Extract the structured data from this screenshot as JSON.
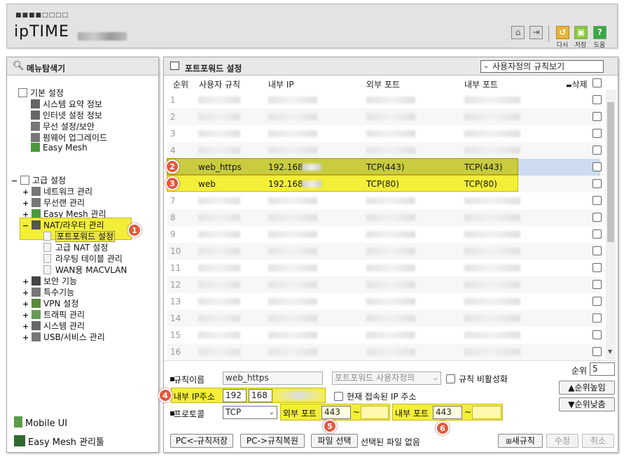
{
  "header": {
    "brand_dots": "■■■■□□□□",
    "brand": "ipTIME",
    "buttons": [
      {
        "label": "다시",
        "icon": "refresh-icon"
      },
      {
        "label": "저장",
        "icon": "save-icon"
      },
      {
        "label": "도움",
        "icon": "help-icon"
      }
    ]
  },
  "sidebar": {
    "title": "메뉴탐색기",
    "basic": {
      "label": "기본 설정",
      "items": [
        "시스템 요약 정보",
        "인터넷 설정 정보",
        "무선 설정/보안",
        "펌웨어 업그레이드",
        "Easy Mesh"
      ]
    },
    "advanced": {
      "label": "고급 설정",
      "items": [
        "네트워크 관리",
        "무선랜 관리",
        "Easy Mesh 관리",
        "NAT/라우터 관리"
      ]
    },
    "nat_children": [
      "포트포워드 설정",
      "고급 NAT 설정",
      "라우팅 테이블 관리",
      "WAN용 MACVLAN"
    ],
    "advanced_rest": [
      "보안 기능",
      "특수기능",
      "VPN 설정",
      "트래픽 관리",
      "시스템 관리",
      "USB/서비스 관리"
    ],
    "bottom": [
      "Mobile UI",
      "Easy Mesh 관리툴"
    ],
    "badge1": "1"
  },
  "main": {
    "title": "포트포워드 설정",
    "view_select": "사용자정의 규칙보기",
    "columns": [
      "순위",
      "사용자 규칙",
      "내부 IP",
      "외부 포트",
      "내부 포트",
      "삭제"
    ],
    "rows": [
      {
        "n": "1",
        "name": "",
        "ip": "",
        "ext": "",
        "int": ""
      },
      {
        "n": "2",
        "name": "",
        "ip": "",
        "ext": "",
        "int": ""
      },
      {
        "n": "3",
        "name": "",
        "ip": "",
        "ext": "",
        "int": ""
      },
      {
        "n": "4",
        "name": "",
        "ip": "",
        "ext": "",
        "int": ""
      },
      {
        "n": "",
        "name": "web_https",
        "ip": "192.168",
        "ext": "TCP(443)",
        "int": "TCP(443)",
        "badge": "2"
      },
      {
        "n": "",
        "name": "web",
        "ip": "192.168",
        "ext": "TCP(80)",
        "int": "TCP(80)",
        "badge": "3"
      },
      {
        "n": "7",
        "name": "",
        "ip": "",
        "ext": "",
        "int": ""
      },
      {
        "n": "8",
        "name": "",
        "ip": "",
        "ext": "",
        "int": ""
      },
      {
        "n": "9",
        "name": "",
        "ip": "",
        "ext": "",
        "int": ""
      },
      {
        "n": "10",
        "name": "",
        "ip": "",
        "ext": "",
        "int": ""
      },
      {
        "n": "11",
        "name": "",
        "ip": "",
        "ext": "",
        "int": ""
      },
      {
        "n": "12",
        "name": "",
        "ip": "",
        "ext": "",
        "int": ""
      },
      {
        "n": "13",
        "name": "",
        "ip": "",
        "ext": "",
        "int": ""
      },
      {
        "n": "14",
        "name": "",
        "ip": "",
        "ext": "",
        "int": ""
      },
      {
        "n": "15",
        "name": "",
        "ip": "",
        "ext": "",
        "int": ""
      },
      {
        "n": "16",
        "name": "",
        "ip": "",
        "ext": "",
        "int": ""
      }
    ],
    "form": {
      "rule_name_label": "규칙이름",
      "rule_name_value": "web_https",
      "rule_type": "포트포워드 사용자정의",
      "disable_label": "규칙 비활성화",
      "rank_label": "순위",
      "rank_value": "5",
      "up_label": "▲순위높임",
      "down_label": "▼순위낮춤",
      "ip_label": "내부 IP주소",
      "ip1": "192",
      "ip2": "168",
      "current_ip_label": "현재 접속된 IP 주소",
      "protocol_label": "프로토콜",
      "protocol_value": "TCP",
      "ext_port_label": "외부 포트",
      "ext_port_value": "443",
      "int_port_label": "내부 포트",
      "int_port_value": "443",
      "tilde": "~",
      "badge4": "4",
      "badge5": "5",
      "badge6": "6"
    },
    "buttons": {
      "pc_save": "PC<-규칙저장",
      "pc_restore": "PC->규칙복원",
      "file_select": "파일 선택",
      "file_status": "선택된 파일 없음",
      "new_rule": "새규칙",
      "modify": "수정",
      "cancel": "취소"
    }
  }
}
